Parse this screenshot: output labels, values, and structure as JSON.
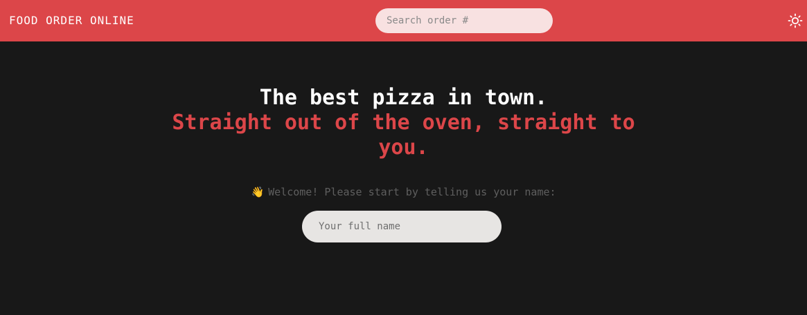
{
  "header": {
    "brand": "FOOD ORDER ONLINE",
    "search_placeholder": "Search order #",
    "theme_toggle_icon": "sun-icon",
    "background_color": "#dc4649"
  },
  "hero": {
    "line1": "The best pizza in town.",
    "line2": "Straight out of the oven, straight to you.",
    "accent_color": "#dc4649"
  },
  "welcome": {
    "icon": "👋",
    "icon_name": "waving-hand-icon",
    "text": "Welcome! Please start by telling us your name:"
  },
  "name_input": {
    "placeholder": "Your full name"
  }
}
